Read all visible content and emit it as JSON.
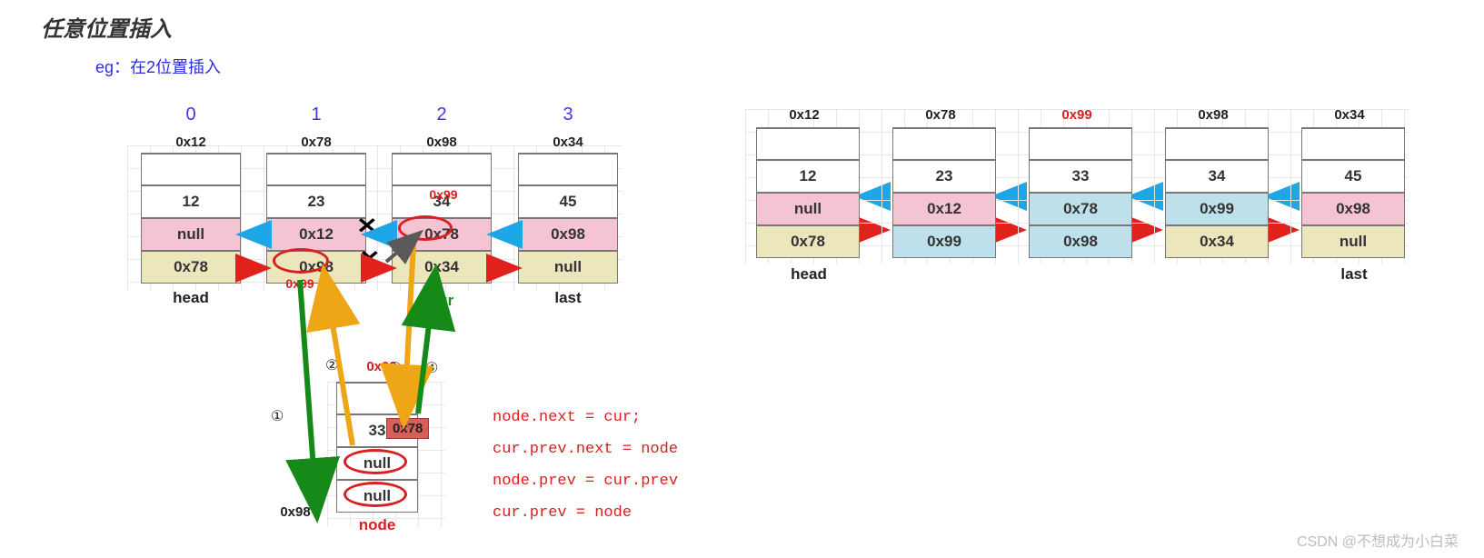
{
  "title": "任意位置插入",
  "subtitle": "eg：在2位置插入",
  "left": {
    "indices": [
      "0",
      "1",
      "2",
      "3"
    ],
    "addrs": [
      "0x12",
      "0x78",
      "0x98",
      "0x34"
    ],
    "nodes": [
      {
        "val": "12",
        "prev": "null",
        "next": "0x78"
      },
      {
        "val": "23",
        "prev": "0x12",
        "next": "0x98"
      },
      {
        "val": "34",
        "prev": "0x78",
        "next": "0x34"
      },
      {
        "val": "45",
        "prev": "0x98",
        "next": "null"
      }
    ],
    "head": "head",
    "last": "last",
    "cur": "cur",
    "noteAddr1": "0x99",
    "noteAddr2": "0x99",
    "newNode": {
      "addr": "0x99",
      "val": "33",
      "prev": "null",
      "next": "null",
      "tag": "0x78",
      "sideAddr": "0x98",
      "label": "node"
    },
    "steps": [
      "①",
      "②",
      "③",
      "④"
    ],
    "code": [
      "node.next = cur;",
      "cur.prev.next = node",
      "node.prev = cur.prev",
      "cur.prev = node"
    ]
  },
  "right": {
    "addrs": [
      "0x12",
      "0x78",
      "0x99",
      "0x98",
      "0x34"
    ],
    "nodes": [
      {
        "val": "12",
        "prev": "null",
        "next": "0x78",
        "newPrev": false,
        "newNext": false
      },
      {
        "val": "23",
        "prev": "0x12",
        "next": "0x99",
        "newPrev": false,
        "newNext": true
      },
      {
        "val": "33",
        "prev": "0x78",
        "next": "0x98",
        "newPrev": true,
        "newNext": true
      },
      {
        "val": "34",
        "prev": "0x99",
        "next": "0x34",
        "newPrev": true,
        "newNext": false
      },
      {
        "val": "45",
        "prev": "0x98",
        "next": "null",
        "newPrev": false,
        "newNext": false
      }
    ],
    "head": "head",
    "last": "last"
  },
  "watermark": "CSDN @不想成为小白菜"
}
